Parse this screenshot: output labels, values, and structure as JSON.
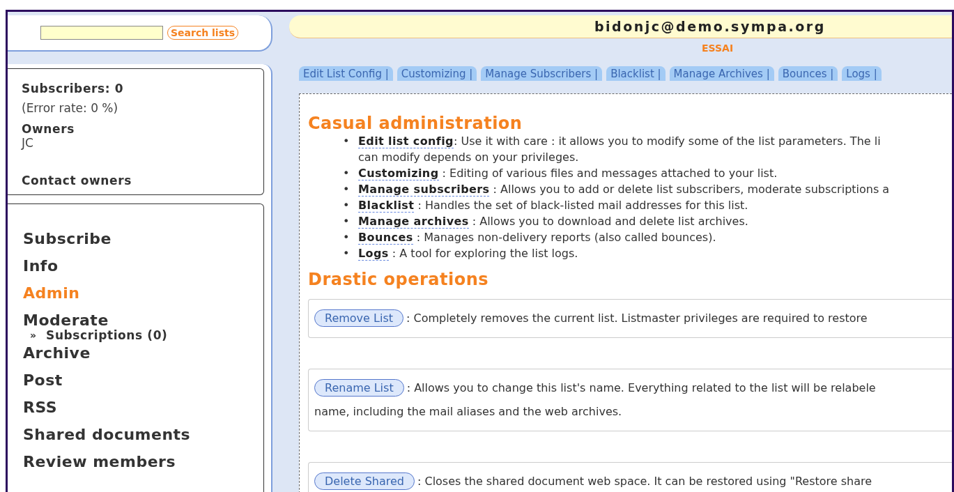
{
  "search": {
    "button": "Search lists"
  },
  "list_info": {
    "subscribers": "Subscribers: 0",
    "error_rate": "(Error rate: 0 %)",
    "owners_label": "Owners",
    "owners": "JC",
    "contact": "Contact owners"
  },
  "menu": [
    {
      "label": "Subscribe",
      "selected": false
    },
    {
      "label": "Info",
      "selected": false
    },
    {
      "label": "Admin",
      "selected": true
    },
    {
      "label": "Moderate",
      "selected": false,
      "children": [
        {
          "marker": "»",
          "label": "Subscriptions (0)"
        }
      ]
    },
    {
      "label": "Archive",
      "selected": false
    },
    {
      "label": "Post",
      "selected": false
    },
    {
      "label": "RSS",
      "selected": false
    },
    {
      "label": "Shared documents",
      "selected": false
    },
    {
      "label": "Review members",
      "selected": false
    }
  ],
  "header": {
    "email": "bidonjc@demo.sympa.org",
    "list_name": "ESSAI"
  },
  "tabs": [
    "Edit List Config |",
    "Customizing |",
    "Manage Subscribers |",
    "Blacklist |",
    "Manage Archives |",
    "Bounces |",
    "Logs |"
  ],
  "casual": {
    "title": "Casual administration",
    "items": [
      {
        "bullet": "•",
        "term": "Edit list config",
        "text": ": Use it with care : it allows you to modify some of the list parameters. The li\ncan modify depends on your privileges."
      },
      {
        "bullet": "•",
        "term": "Customizing",
        "text": " : Editing of various files and messages attached to your list."
      },
      {
        "bullet": "•",
        "term": "Manage subscribers",
        "text": " : Allows you to add or delete list subscribers, moderate subscriptions a"
      },
      {
        "bullet": "•",
        "term": "Blacklist",
        "text": " : Handles the set of black-listed mail addresses for this list."
      },
      {
        "bullet": "•",
        "term": "Manage archives",
        "text": " : Allows you to download and delete list archives."
      },
      {
        "bullet": "•",
        "term": "Bounces",
        "text": " : Manages non-delivery reports (also called bounces)."
      },
      {
        "bullet": "•",
        "term": "Logs",
        "text": " : A tool for exploring the list logs."
      }
    ]
  },
  "drastic": {
    "title": "Drastic operations",
    "operations": [
      {
        "button": "Remove List",
        "text": ": Completely removes the current list. Listmaster privileges are required to restore"
      },
      {
        "button": "Rename List",
        "text": ": Allows you to change this list's name. Everything related to the list will be relabele\nname, including the mail aliases and the web archives."
      },
      {
        "button": "Delete Shared",
        "text": ": Closes the shared document web space. It can be restored using \"Restore share"
      }
    ]
  }
}
